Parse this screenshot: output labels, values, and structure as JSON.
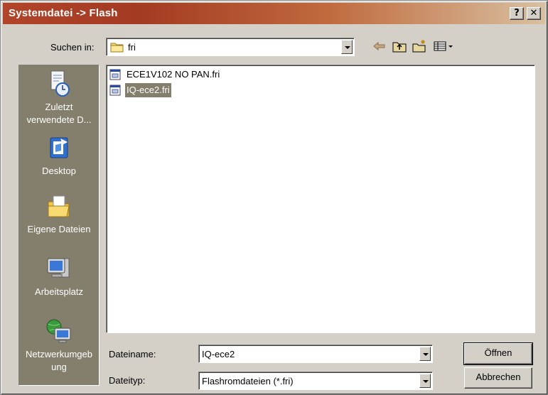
{
  "window": {
    "title": "Systemdatei -> Flash",
    "help_label": "?",
    "close_label": "✕"
  },
  "lookin": {
    "label": "Suchen in:",
    "value": "fri"
  },
  "places": [
    {
      "label_line1": "Zuletzt",
      "label_line2": "verwendete D...",
      "icon": "recent-documents-icon"
    },
    {
      "label_line1": "Desktop",
      "label_line2": "",
      "icon": "desktop-icon"
    },
    {
      "label_line1": "Eigene Dateien",
      "label_line2": "",
      "icon": "my-documents-icon"
    },
    {
      "label_line1": "Arbeitsplatz",
      "label_line2": "",
      "icon": "my-computer-icon"
    },
    {
      "label_line1": "Netzwerkumgeb",
      "label_line2": "ung",
      "icon": "network-places-icon"
    }
  ],
  "files": [
    {
      "name": "ECE1V102 NO PAN.fri",
      "selected": false
    },
    {
      "name": "IQ-ece2.fri",
      "selected": true
    }
  ],
  "filename": {
    "label": "Dateiname:",
    "value": "IQ-ece2"
  },
  "filetype": {
    "label": "Dateityp:",
    "value": "Flashromdateien (*.fri)"
  },
  "buttons": {
    "open": "Öffnen",
    "cancel": "Abbrechen"
  },
  "colors": {
    "title_start": "#b1442a",
    "places_bg": "#847f6d",
    "selection_bg": "#847f6d"
  }
}
